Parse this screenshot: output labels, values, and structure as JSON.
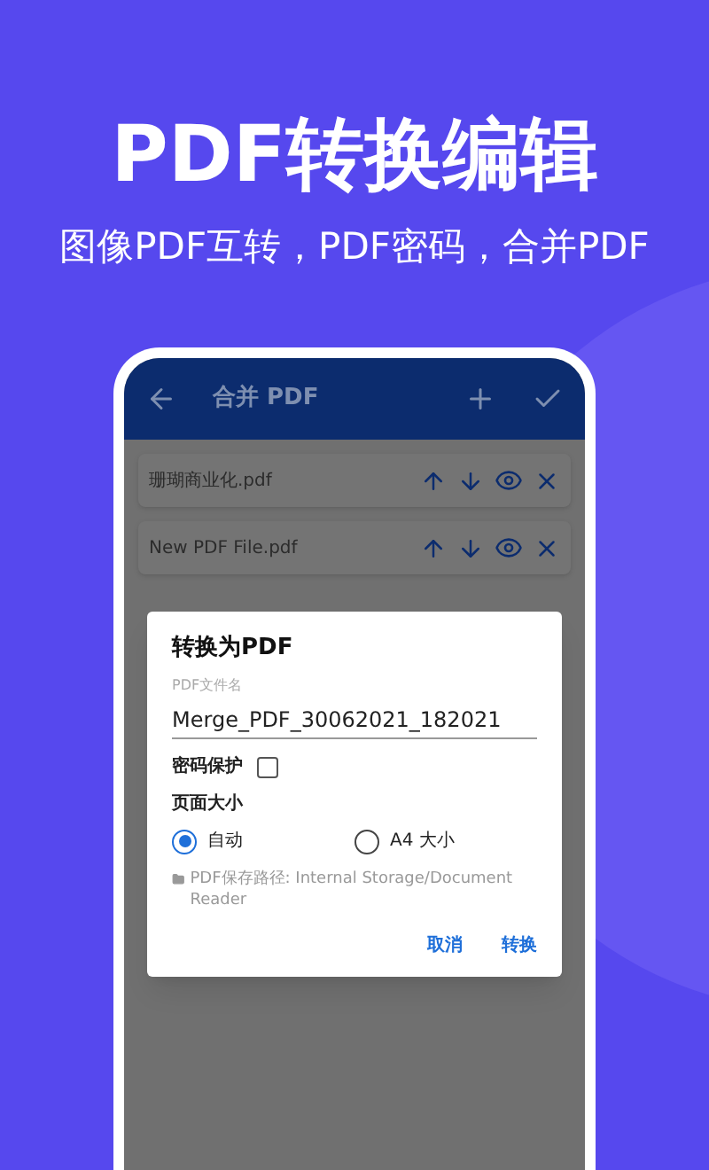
{
  "hero": {
    "title": "PDF转换编辑",
    "subtitle": "图像PDF互转，PDF密码，合并PDF"
  },
  "app_bar": {
    "title": "合并 PDF"
  },
  "files": [
    {
      "name": "珊瑚商业化.pdf"
    },
    {
      "name": "New PDF File.pdf"
    }
  ],
  "dialog": {
    "title": "转换为PDF",
    "field": {
      "label": "PDF文件名",
      "value": "Merge_PDF_30062021_182021"
    },
    "password": {
      "label": "密码保护",
      "checked": false
    },
    "page_size": {
      "label": "页面大小",
      "options": [
        {
          "label": "自动",
          "selected": true
        },
        {
          "label": "A4 大小",
          "selected": false
        }
      ]
    },
    "path": "PDF保存路径: Internal Storage/Document Reader",
    "buttons": [
      "取消",
      "转换"
    ]
  }
}
